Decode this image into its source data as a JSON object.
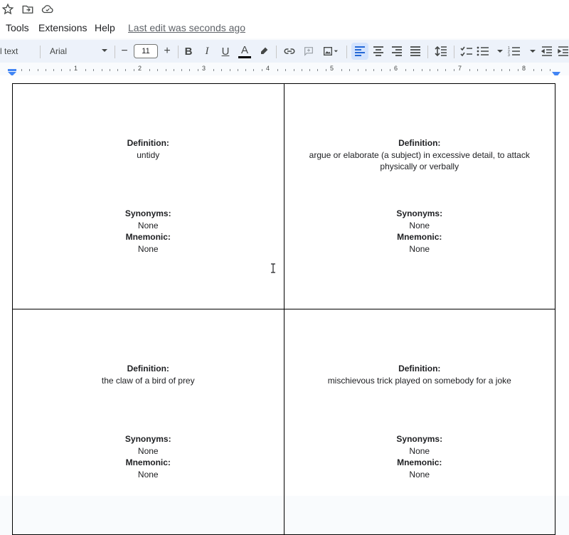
{
  "top_icons": [
    "star-icon",
    "move-to-folder-icon",
    "cloud-saved-icon"
  ],
  "menu": {
    "items": [
      "Tools",
      "Extensions",
      "Help"
    ],
    "last_edit": "Last edit was seconds ago"
  },
  "toolbar": {
    "style": "l text",
    "font": "Arial",
    "font_size": "11",
    "minus": "−",
    "plus": "+",
    "bold": "B",
    "italic": "I",
    "underline": "U",
    "text_color": "A",
    "text_color_value": "#000000"
  },
  "ruler": {
    "numbers": [
      "1",
      "2",
      "3",
      "4",
      "5",
      "6",
      "7",
      "8"
    ]
  },
  "cards": [
    {
      "definition_label": "Definition:",
      "definition": "untidy",
      "synonyms_label": "Synonyms:",
      "synonyms": "None",
      "mnemonic_label": "Mnemonic:",
      "mnemonic": "None"
    },
    {
      "definition_label": "Definition:",
      "definition": "argue or elaborate (a subject) in excessive detail, to attack physically or verbally",
      "synonyms_label": "Synonyms:",
      "synonyms": "None",
      "mnemonic_label": "Mnemonic:",
      "mnemonic": "None"
    },
    {
      "definition_label": "Definition:",
      "definition": "the claw of a bird of prey",
      "synonyms_label": "Synonyms:",
      "synonyms": "None",
      "mnemonic_label": "Mnemonic:",
      "mnemonic": "None"
    },
    {
      "definition_label": "Definition:",
      "definition": "mischievous trick played on somebody for a joke",
      "synonyms_label": "Synonyms:",
      "synonyms": "None",
      "mnemonic_label": "Mnemonic:",
      "mnemonic": "None"
    }
  ]
}
